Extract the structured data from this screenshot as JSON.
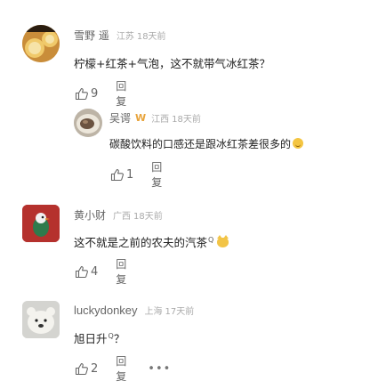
{
  "comments": [
    {
      "name": "雪野 遥",
      "location": "江苏",
      "time": "18天前",
      "text": "柠檬+红茶+气泡，这不就带气冰红茶？",
      "likes": "9",
      "reply_label": "回复"
    },
    {
      "name": "吴谔",
      "badge": "W",
      "location": "江西",
      "time": "18天前",
      "text": "碳酸饮料的口感还是跟冰红茶差很多的",
      "likes": "1",
      "reply_label": "回复"
    },
    {
      "name": "黄小财",
      "location": "广西",
      "time": "18天前",
      "text": "这不就是之前的农夫的汽茶",
      "superscript": "Q",
      "likes": "4",
      "reply_label": "回复"
    },
    {
      "name": "luckydonkey",
      "location": "上海",
      "time": "17天前",
      "text": "旭日升",
      "superscript": "Q",
      "text_suffix": "？",
      "likes": "2",
      "reply_label": "回复",
      "more": "•••"
    }
  ],
  "colors": {
    "text": "#222222",
    "meta": "#aaaaaa",
    "name": "#666666",
    "badge": "#e8a43c"
  },
  "icons": {
    "like": "thumbs-up-icon",
    "more": "more-dots-icon",
    "emoji_smile": "smile-emoji-icon",
    "emoji_cat": "cat-emoji-icon"
  }
}
